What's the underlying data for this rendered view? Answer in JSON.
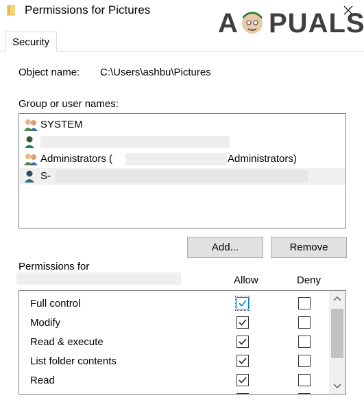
{
  "window": {
    "title": "Permissions for Pictures",
    "close_icon": "close-icon"
  },
  "watermark": {
    "a": "A",
    "rest": "PUALS"
  },
  "tabs": [
    {
      "label": "Security",
      "selected": true
    }
  ],
  "object": {
    "label": "Object name:",
    "value": "C:\\Users\\ashbu\\Pictures"
  },
  "group_label": "Group or user names:",
  "users": [
    {
      "label": "SYSTEM",
      "icon": "group-users-icon",
      "selected": false
    },
    {
      "label": "",
      "icon": "user-icon",
      "selected": false
    },
    {
      "label_pre": "Administrators (",
      "label_post": "Administrators)",
      "icon": "group-users-icon",
      "selected": false
    },
    {
      "label": "S-",
      "icon": "user-icon",
      "selected": true
    }
  ],
  "buttons": {
    "add": "Add...",
    "remove": "Remove"
  },
  "permissions": {
    "label": "Permissions for",
    "allow_header": "Allow",
    "deny_header": "Deny",
    "rows": [
      {
        "label": "Full control",
        "allow": true,
        "deny": false
      },
      {
        "label": "Modify",
        "allow": true,
        "deny": false
      },
      {
        "label": "Read & execute",
        "allow": true,
        "deny": false
      },
      {
        "label": "List folder contents",
        "allow": true,
        "deny": false
      },
      {
        "label": "Read",
        "allow": true,
        "deny": false
      }
    ]
  },
  "colors": {
    "check_focus": "#0078d7",
    "selection": "#f0f0f0",
    "button_face": "#e1e1e1"
  }
}
